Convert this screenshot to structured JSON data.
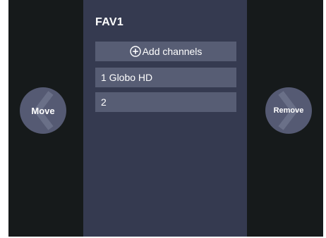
{
  "panel": {
    "title": "FAV1",
    "add_button_label": "Add channels",
    "channels": [
      {
        "label": "1 Globo HD"
      },
      {
        "label": "2"
      }
    ]
  },
  "nav": {
    "left_label": "Move",
    "right_label": "Remove"
  },
  "icons": {
    "add": "plus-circle-icon",
    "left": "chevron-left-icon",
    "right": "chevron-right-icon"
  },
  "colors": {
    "background": "#161a1b",
    "panel": "#353a50",
    "row": "#575d74",
    "nav_button": "#555a73",
    "text": "#ffffff"
  }
}
